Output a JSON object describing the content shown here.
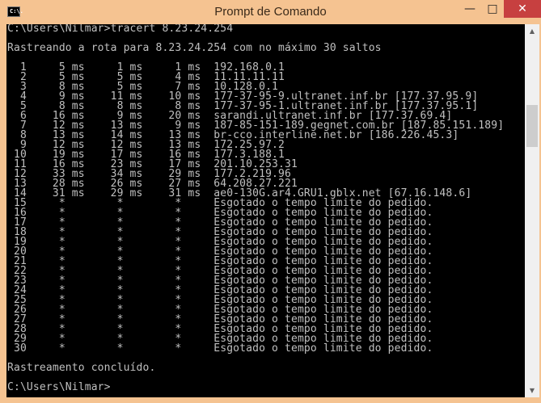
{
  "window": {
    "title": "Prompt de Comando",
    "icon_label": "C:\\.",
    "minimize": "—",
    "maximize": "□",
    "close": "✕"
  },
  "console": {
    "lines": [
      "C:\\Users\\Nilmar>tracert 8.23.24.254",
      "",
      "Rastreando a rota para 8.23.24.254 com no máximo 30 saltos",
      "",
      "  1     5 ms     1 ms     1 ms  192.168.0.1",
      "  2     5 ms     5 ms     4 ms  11.11.11.11",
      "  3     8 ms     5 ms     7 ms  10.128.0.1",
      "  4     9 ms    11 ms    10 ms  177-37-95-9.ultranet.inf.br [177.37.95.9]",
      "  5     8 ms     8 ms     8 ms  177-37-95-1.ultranet.inf.br [177.37.95.1]",
      "  6    16 ms     9 ms    20 ms  sarandi.ultranet.inf.br [177.37.69.4]",
      "  7    12 ms    13 ms     9 ms  187-85-151-189.gegnet.com.br [187.85.151.189]",
      "  8    13 ms    14 ms    13 ms  br-cco.interline.net.br [186.226.45.3]",
      "  9    12 ms    12 ms    13 ms  172.25.97.2",
      " 10    19 ms    17 ms    16 ms  177.3.188.1",
      " 11    16 ms    23 ms    17 ms  201.10.253.31",
      " 12    33 ms    34 ms    29 ms  177.2.219.96",
      " 13    28 ms    26 ms    27 ms  64.208.27.221",
      " 14    31 ms    29 ms    31 ms  ae0-130G.ar4.GRU1.gblx.net [67.16.148.6]",
      " 15     *        *        *     Esgotado o tempo limite do pedido.",
      " 16     *        *        *     Esgotado o tempo limite do pedido.",
      " 17     *        *        *     Esgotado o tempo limite do pedido.",
      " 18     *        *        *     Esgotado o tempo limite do pedido.",
      " 19     *        *        *     Esgotado o tempo limite do pedido.",
      " 20     *        *        *     Esgotado o tempo limite do pedido.",
      " 21     *        *        *     Esgotado o tempo limite do pedido.",
      " 22     *        *        *     Esgotado o tempo limite do pedido.",
      " 23     *        *        *     Esgotado o tempo limite do pedido.",
      " 24     *        *        *     Esgotado o tempo limite do pedido.",
      " 25     *        *        *     Esgotado o tempo limite do pedido.",
      " 26     *        *        *     Esgotado o tempo limite do pedido.",
      " 27     *        *        *     Esgotado o tempo limite do pedido.",
      " 28     *        *        *     Esgotado o tempo limite do pedido.",
      " 29     *        *        *     Esgotado o tempo limite do pedido.",
      " 30     *        *        *     Esgotado o tempo limite do pedido.",
      "",
      "Rastreamento concluído.",
      "",
      "C:\\Users\\Nilmar>"
    ]
  },
  "scrollbar": {
    "up_arrow": "▲",
    "down_arrow": "▼"
  },
  "colors": {
    "titlebar": "#f5c391",
    "console_bg": "#000000",
    "console_text": "#c0c0c0"
  }
}
